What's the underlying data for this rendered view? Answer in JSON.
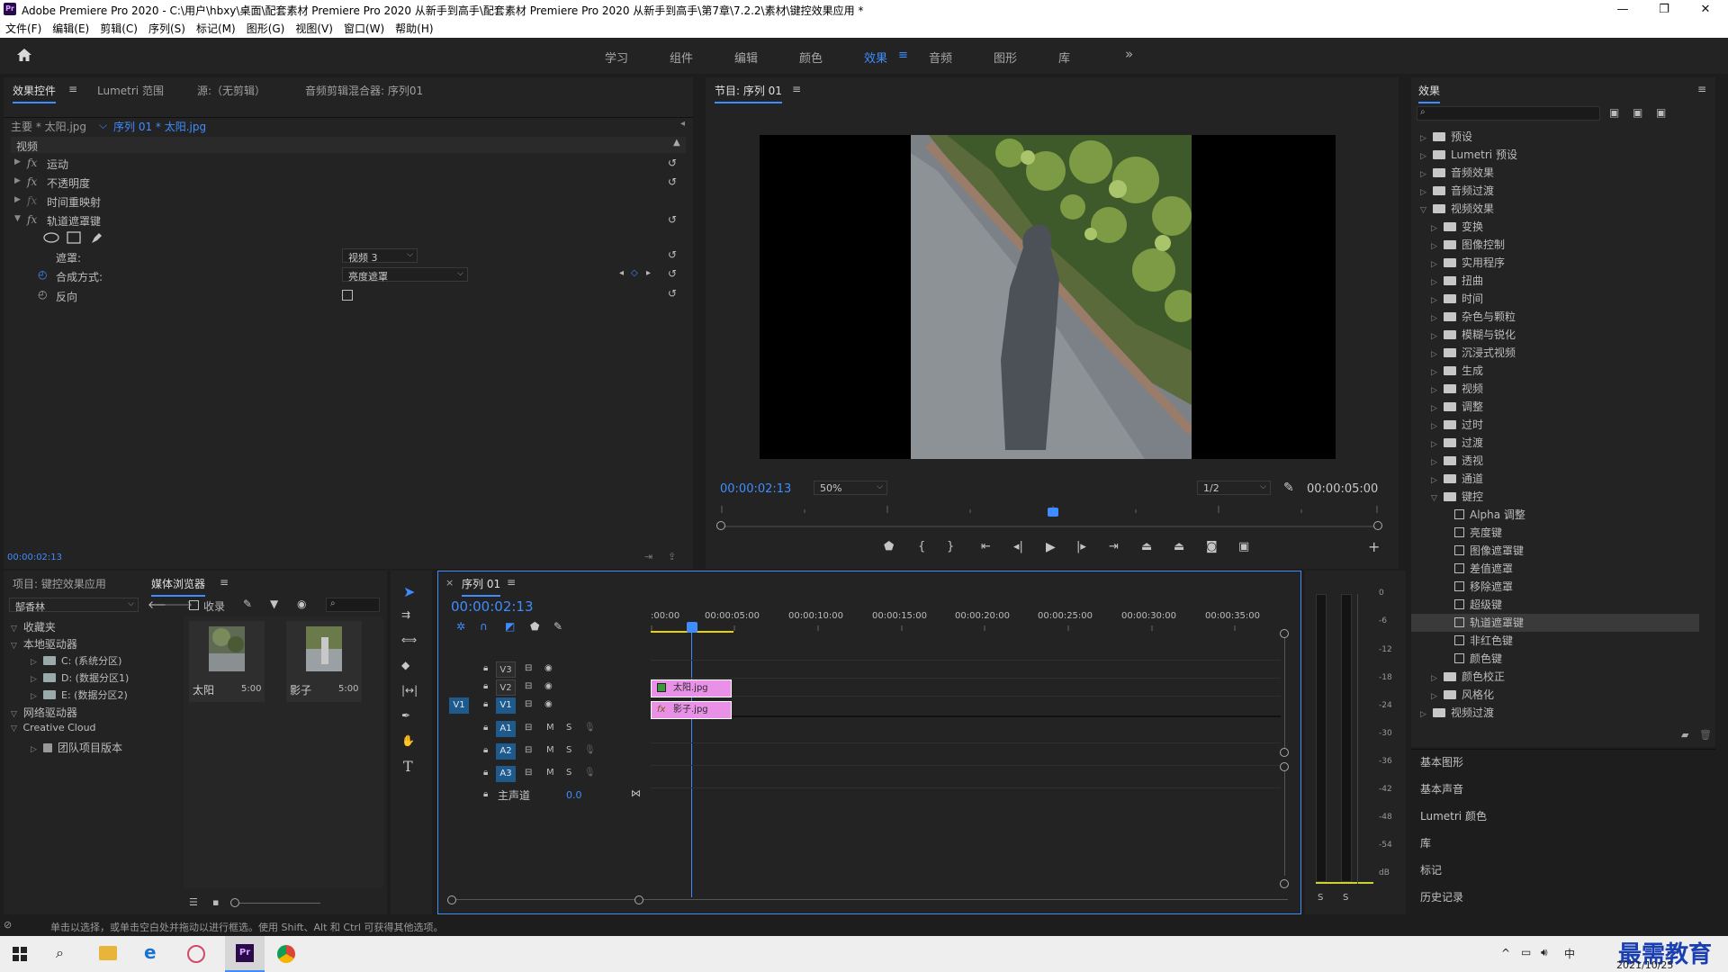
{
  "window": {
    "title": "Adobe Premiere Pro 2020 - C:\\用户\\hbxy\\桌面\\配套素材 Premiere Pro 2020 从新手到高手\\配套素材 Premiere Pro 2020 从新手到高手\\第7章\\7.2.2\\素材\\键控效果应用 *",
    "logo": "Pr"
  },
  "menu": [
    "文件(F)",
    "编辑(E)",
    "剪辑(C)",
    "序列(S)",
    "标记(M)",
    "图形(G)",
    "视图(V)",
    "窗口(W)",
    "帮助(H)"
  ],
  "workspaces": {
    "tabs": [
      "学习",
      "组件",
      "编辑",
      "颜色",
      "效果",
      "音频",
      "图形",
      "库"
    ],
    "active": "效果",
    "more": "»"
  },
  "source_panel": {
    "tabs": [
      "效果控件",
      "Lumetri 范围",
      "源:（无剪辑）",
      "音频剪辑混合器: 序列01"
    ],
    "master_clip": "主要 * 太阳.jpg",
    "sequence_clip": "序列 01 * 太阳.jpg",
    "section_video": "视频",
    "rows": [
      {
        "name": "运动",
        "fx": true
      },
      {
        "name": "不透明度",
        "fx": true
      },
      {
        "name": "时间重映射",
        "fx": true
      },
      {
        "name": "轨道遮罩键",
        "fx": true
      }
    ],
    "mask_label": "遮罩:",
    "mask_value": "视频 3",
    "composite_label": "合成方式:",
    "composite_value": "亮度遮罩",
    "reverse_label": "反向",
    "reverse_checked": false,
    "timecode": "00:00:02:13"
  },
  "program_monitor": {
    "title": "节目: 序列 01",
    "timecode": "00:00:02:13",
    "zoom": "50%",
    "resolution": "1/2",
    "duration": "00:00:05:00"
  },
  "project_panel": {
    "tabs": [
      "项目: 键控效果应用",
      "媒体浏览器"
    ],
    "font_select": "郜香林",
    "ingest_label": "收录",
    "tree": [
      {
        "label": "收藏夹",
        "level": 0,
        "expanded": true
      },
      {
        "label": "本地驱动器",
        "level": 0,
        "expanded": true
      },
      {
        "label": "C: (系统分区)",
        "level": 1
      },
      {
        "label": "D: (数据分区1)",
        "level": 1
      },
      {
        "label": "E: (数据分区2)",
        "level": 1
      },
      {
        "label": "网络驱动器",
        "level": 0,
        "expanded": true
      },
      {
        "label": "Creative Cloud",
        "level": 0,
        "expanded": true
      },
      {
        "label": "团队项目版本",
        "level": 1
      }
    ],
    "thumbs": [
      {
        "name": "太阳",
        "duration": "5:00"
      },
      {
        "name": "影子",
        "duration": "5:00"
      }
    ]
  },
  "timeline": {
    "title": "序列 01",
    "timecode": "00:00:02:13",
    "ruler": [
      ":00:00",
      "00:00:05:00",
      "00:00:10:00",
      "00:00:15:00",
      "00:00:20:00",
      "00:00:25:00",
      "00:00:30:00",
      "00:00:35:00"
    ],
    "video_tracks": [
      "V3",
      "V2",
      "V1"
    ],
    "audio_tracks": [
      "A1",
      "A2",
      "A3"
    ],
    "source_patch": "V1",
    "mute": "M",
    "solo": "S",
    "master_label": "主声道",
    "master_value": "0.0",
    "clips": [
      {
        "name": "太阳.jpg",
        "track": "V2"
      },
      {
        "name": "影子.jpg",
        "track": "V1"
      }
    ]
  },
  "meter": {
    "scale": [
      "0",
      "-6",
      "-12",
      "-18",
      "-24",
      "-30",
      "-36",
      "-42",
      "-48",
      "-54",
      "dB"
    ],
    "solo": [
      "S",
      "S"
    ]
  },
  "effects_panel": {
    "title": "效果",
    "tree": [
      {
        "label": "预设",
        "level": 0,
        "type": "folder"
      },
      {
        "label": "Lumetri 预设",
        "level": 0,
        "type": "folder"
      },
      {
        "label": "音频效果",
        "level": 0,
        "type": "folder"
      },
      {
        "label": "音频过渡",
        "level": 0,
        "type": "folder"
      },
      {
        "label": "视频效果",
        "level": 0,
        "type": "folder",
        "expanded": true
      },
      {
        "label": "变换",
        "level": 1,
        "type": "folder"
      },
      {
        "label": "图像控制",
        "level": 1,
        "type": "folder"
      },
      {
        "label": "实用程序",
        "level": 1,
        "type": "folder"
      },
      {
        "label": "扭曲",
        "level": 1,
        "type": "folder"
      },
      {
        "label": "时间",
        "level": 1,
        "type": "folder"
      },
      {
        "label": "杂色与颗粒",
        "level": 1,
        "type": "folder"
      },
      {
        "label": "模糊与锐化",
        "level": 1,
        "type": "folder"
      },
      {
        "label": "沉浸式视频",
        "level": 1,
        "type": "folder"
      },
      {
        "label": "生成",
        "level": 1,
        "type": "folder"
      },
      {
        "label": "视频",
        "level": 1,
        "type": "folder"
      },
      {
        "label": "调整",
        "level": 1,
        "type": "folder"
      },
      {
        "label": "过时",
        "level": 1,
        "type": "folder"
      },
      {
        "label": "过渡",
        "level": 1,
        "type": "folder"
      },
      {
        "label": "透视",
        "level": 1,
        "type": "folder"
      },
      {
        "label": "通道",
        "level": 1,
        "type": "folder"
      },
      {
        "label": "键控",
        "level": 1,
        "type": "folder",
        "expanded": true
      },
      {
        "label": "Alpha 调整",
        "level": 2,
        "type": "fx"
      },
      {
        "label": "亮度键",
        "level": 2,
        "type": "fx"
      },
      {
        "label": "图像遮罩键",
        "level": 2,
        "type": "fx"
      },
      {
        "label": "差值遮罩",
        "level": 2,
        "type": "fx"
      },
      {
        "label": "移除遮罩",
        "level": 2,
        "type": "fx"
      },
      {
        "label": "超级键",
        "level": 2,
        "type": "fx"
      },
      {
        "label": "轨道遮罩键",
        "level": 2,
        "type": "fx",
        "selected": true
      },
      {
        "label": "非红色键",
        "level": 2,
        "type": "fx"
      },
      {
        "label": "颜色键",
        "level": 2,
        "type": "fx"
      },
      {
        "label": "颜色校正",
        "level": 1,
        "type": "folder"
      },
      {
        "label": "风格化",
        "level": 1,
        "type": "folder"
      },
      {
        "label": "视频过渡",
        "level": 0,
        "type": "folder"
      }
    ],
    "side_sections": [
      "基本图形",
      "基本声音",
      "Lumetri 颜色",
      "库",
      "标记",
      "历史记录"
    ]
  },
  "status": {
    "hint": "单击以选择，或单击空白处并拖动以进行框选。使用 Shift、Alt 和 Ctrl 可获得其他选项。"
  },
  "taskbar": {
    "date": "2021/10/25",
    "ime": "中",
    "watermark": "最需教育"
  },
  "colors": {
    "accent": "#3f8cff",
    "clip": "#e891e6",
    "track_badge": "#1e5a8c",
    "work_area": "#e8d200"
  }
}
